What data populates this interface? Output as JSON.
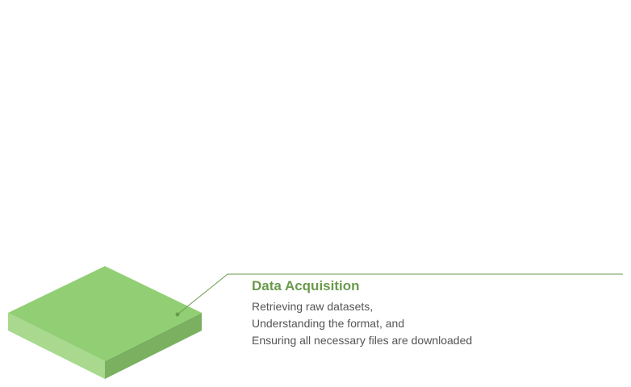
{
  "diagram": {
    "step": {
      "title": "Data Acquisition",
      "description_lines": [
        "Retrieving raw datasets,",
        "Understanding the format, and",
        "Ensuring all necessary files are downloaded"
      ]
    },
    "colors": {
      "accent": "#6a9a4c",
      "block_top": "#92cf74",
      "block_left": "#a8d98e",
      "block_right": "#7bb060",
      "leader_line": "#6a9a4c",
      "text": "#555555"
    }
  }
}
